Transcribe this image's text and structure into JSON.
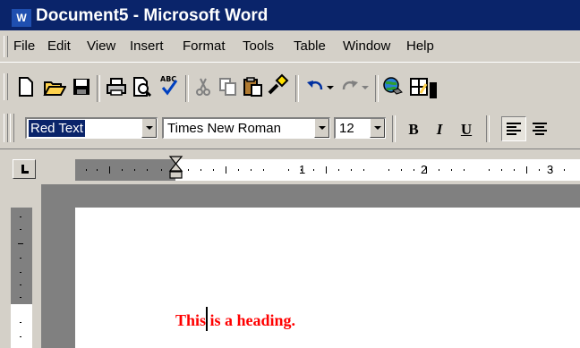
{
  "window": {
    "title": "Document5 - Microsoft Word",
    "app_icon": "word-icon"
  },
  "menu": {
    "items": [
      "File",
      "Edit",
      "View",
      "Insert",
      "Format",
      "Tools",
      "Table",
      "Window",
      "Help"
    ]
  },
  "standard_toolbar": {
    "buttons": [
      {
        "name": "new-document-icon"
      },
      {
        "name": "open-folder-icon"
      },
      {
        "name": "save-disk-icon"
      },
      {
        "name": "print-icon"
      },
      {
        "name": "print-preview-icon"
      },
      {
        "name": "spelling-check-icon"
      },
      {
        "name": "cut-icon"
      },
      {
        "name": "copy-icon"
      },
      {
        "name": "paste-icon"
      },
      {
        "name": "format-painter-icon"
      },
      {
        "name": "undo-icon"
      },
      {
        "name": "redo-icon"
      },
      {
        "name": "hyperlink-icon"
      },
      {
        "name": "tables-borders-icon"
      }
    ],
    "spelling_label": "ABC"
  },
  "formatting_toolbar": {
    "style": "Red Text",
    "font": "Times New Roman",
    "size": "12",
    "bold_label": "B",
    "italic_label": "I",
    "underline_label": "U"
  },
  "ruler": {
    "numbers": [
      "1",
      "2",
      "3"
    ]
  },
  "document": {
    "heading": "This is a heading.",
    "heading_color": "#ff0000"
  },
  "colors": {
    "title_bar": "#0a246a",
    "chrome": "#d4d0c8",
    "selection": "#0a246a"
  }
}
